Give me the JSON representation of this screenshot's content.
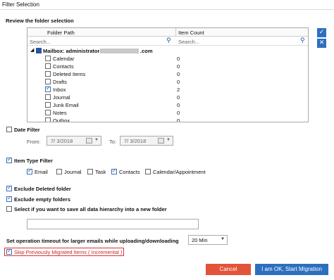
{
  "window": {
    "title": "Filter Selection"
  },
  "review_label": "Review the folder selection",
  "grid": {
    "col_folder": "Folder Path",
    "col_count": "Item Count",
    "search_placeholder": "Search...",
    "search_placeholder2": "Search...",
    "mailbox_label": "Mailbox: administrator@",
    "mailbox_suffix": ".com",
    "rows": [
      {
        "name": "Calendar",
        "count": "0",
        "checked": false
      },
      {
        "name": "Contacts",
        "count": "0",
        "checked": false
      },
      {
        "name": "Deleted Items",
        "count": "0",
        "checked": false
      },
      {
        "name": "Drafts",
        "count": "0",
        "checked": false
      },
      {
        "name": "Inbox",
        "count": "2",
        "checked": true
      },
      {
        "name": "Journal",
        "count": "0",
        "checked": false
      },
      {
        "name": "Junk Email",
        "count": "0",
        "checked": false
      },
      {
        "name": "Notes",
        "count": "0",
        "checked": false
      },
      {
        "name": "Outbox",
        "count": "0",
        "checked": false
      }
    ]
  },
  "date_filter": {
    "label": "Date Filter",
    "checked": false,
    "from_label": "From:",
    "from_value": "7/  3/2018",
    "to_label": "To:",
    "to_value": "7/  3/2018"
  },
  "item_type_filter": {
    "label": "Item Type Filter",
    "checked": true,
    "types": [
      {
        "label": "Email",
        "checked": true
      },
      {
        "label": "Journal",
        "checked": false
      },
      {
        "label": "Task",
        "checked": false
      },
      {
        "label": "Contacts",
        "checked": true
      },
      {
        "label": "Calendar/Appointment",
        "checked": false
      }
    ]
  },
  "options": {
    "exclude_deleted": {
      "label": "Exclude Deleted folder",
      "checked": true
    },
    "exclude_empty": {
      "label": "Exclude empty folders",
      "checked": true
    },
    "save_hierarchy": {
      "label": "Select if you want to save all data hierarchy into a new folder",
      "checked": false
    },
    "folder_name_value": ""
  },
  "timeout": {
    "label": "Set operation timeout for larger emails while uploading/downloading",
    "value": "20 Min"
  },
  "skip_migrated": {
    "label": "Skip Previously Migrated Items ( Incremental )",
    "checked": true
  },
  "buttons": {
    "cancel": "Cancel",
    "start": "I am OK, Start Migration"
  },
  "colors": {
    "cancel_bg": "#e2533a",
    "start_bg": "#2d6fbf",
    "accent": "#2a56a0",
    "red_label": "#c0282f"
  }
}
